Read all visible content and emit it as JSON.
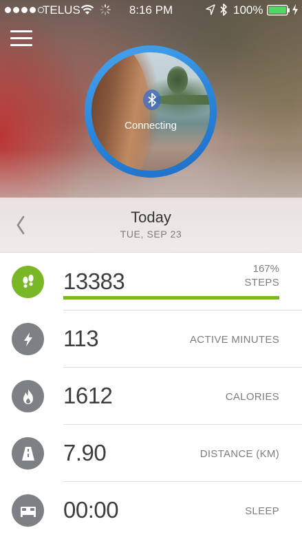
{
  "status_bar": {
    "carrier": "TELUS",
    "time": "8:16 PM",
    "battery": "100%",
    "signal_bars": 4,
    "signal_max": 5
  },
  "hero": {
    "status_text": "Connecting"
  },
  "date_bar": {
    "title": "Today",
    "subtitle": "TUE, SEP 23"
  },
  "stats": [
    {
      "id": "steps",
      "icon": "footprints-icon",
      "value": "13383",
      "label": "STEPS",
      "percent": "167%",
      "progress": 1.0,
      "accent": "#7ab726"
    },
    {
      "id": "active",
      "icon": "lightning-icon",
      "value": "113",
      "label": "ACTIVE MINUTES"
    },
    {
      "id": "calories",
      "icon": "flame-icon",
      "value": "1612",
      "label": "CALORIES"
    },
    {
      "id": "distance",
      "icon": "road-icon",
      "value": "7.90",
      "label": "DISTANCE (KM)"
    },
    {
      "id": "sleep",
      "icon": "bed-icon",
      "value": "00:00",
      "label": "SLEEP"
    }
  ],
  "colors": {
    "accent_green": "#7ab726",
    "ring_blue": "#2a86db",
    "icon_gray": "#7d8085",
    "battery_green": "#4cd964"
  }
}
